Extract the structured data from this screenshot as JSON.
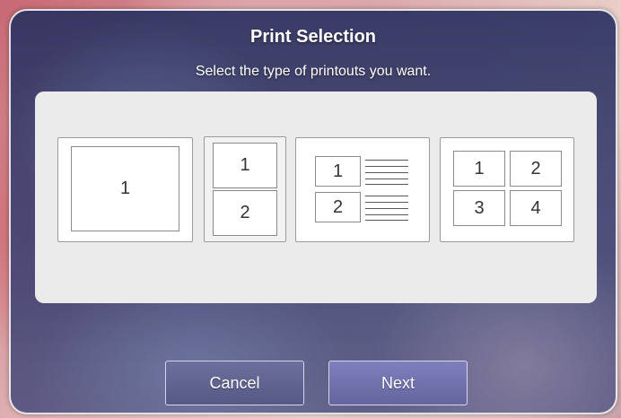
{
  "dialog": {
    "title": "Print Selection",
    "subtitle": "Select the type of printouts you want."
  },
  "options": [
    {
      "name": "1-per-page",
      "cells": [
        "1"
      ]
    },
    {
      "name": "2-per-page",
      "cells": [
        "1",
        "2"
      ]
    },
    {
      "name": "2-per-page-with-notes",
      "cells": [
        "1",
        "2"
      ]
    },
    {
      "name": "4-per-page",
      "cells": [
        "1",
        "2",
        "3",
        "4"
      ]
    }
  ],
  "buttons": {
    "cancel": "Cancel",
    "next": "Next"
  },
  "colors": {
    "dialog_bg": "#2c3260",
    "panel_bg": "#ebebeb",
    "cancel_bg": "#5f618e",
    "next_bg": "#7273ad"
  }
}
